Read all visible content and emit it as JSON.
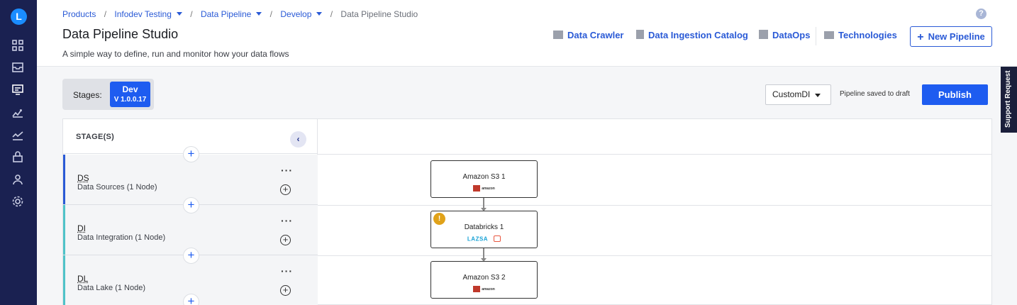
{
  "rail": {
    "logo": "L",
    "icons": [
      "grid-icon",
      "inbox-icon",
      "pipeline-icon",
      "chart-icon",
      "trend-icon",
      "app-icon",
      "team-icon",
      "settings-icon"
    ]
  },
  "breadcrumb": [
    {
      "label": "Products",
      "dropdown": false
    },
    {
      "label": "Infodev Testing",
      "dropdown": true
    },
    {
      "label": "Data Pipeline",
      "dropdown": true
    },
    {
      "label": "Develop",
      "dropdown": true
    },
    {
      "label": "Data Pipeline Studio",
      "dropdown": false
    }
  ],
  "header": {
    "title": "Data Pipeline Studio",
    "subtitle": "A simple way to define, run and monitor how your data flows",
    "links": {
      "data_crawler": "Data Crawler",
      "ingestion_catalog": "Data Ingestion Catalog",
      "dataops": "DataOps",
      "technologies": "Technologies"
    },
    "new_pipeline": "New Pipeline",
    "help": "?"
  },
  "stages_toggle": {
    "label": "Stages:",
    "env": "Dev",
    "version": "V 1.0.0.17"
  },
  "toolbar": {
    "select_value": "CustomDI",
    "saved_text": "Pipeline saved to draft",
    "publish": "Publish"
  },
  "support": "Support Request",
  "canvas": {
    "stages_header": "STAGE(S)",
    "stages": [
      {
        "code": "DS",
        "desc": "Data Sources (1 Node)",
        "color": "#2a5ad6"
      },
      {
        "code": "DI",
        "desc": "Data Integration (1 Node)",
        "color": "#4fc3c8"
      },
      {
        "code": "DL",
        "desc": "Data Lake (1 Node)",
        "color": "#4fc3c8"
      }
    ],
    "nodes": [
      {
        "name": "Amazon S3 1",
        "logo": "amazon-s3",
        "logo_text": "amazon"
      },
      {
        "name": "Databricks 1",
        "logo": "databricks",
        "tag": "LAZSA",
        "warning": true
      },
      {
        "name": "Amazon S3 2",
        "logo": "amazon-s3",
        "logo_text": "amazon"
      }
    ]
  }
}
